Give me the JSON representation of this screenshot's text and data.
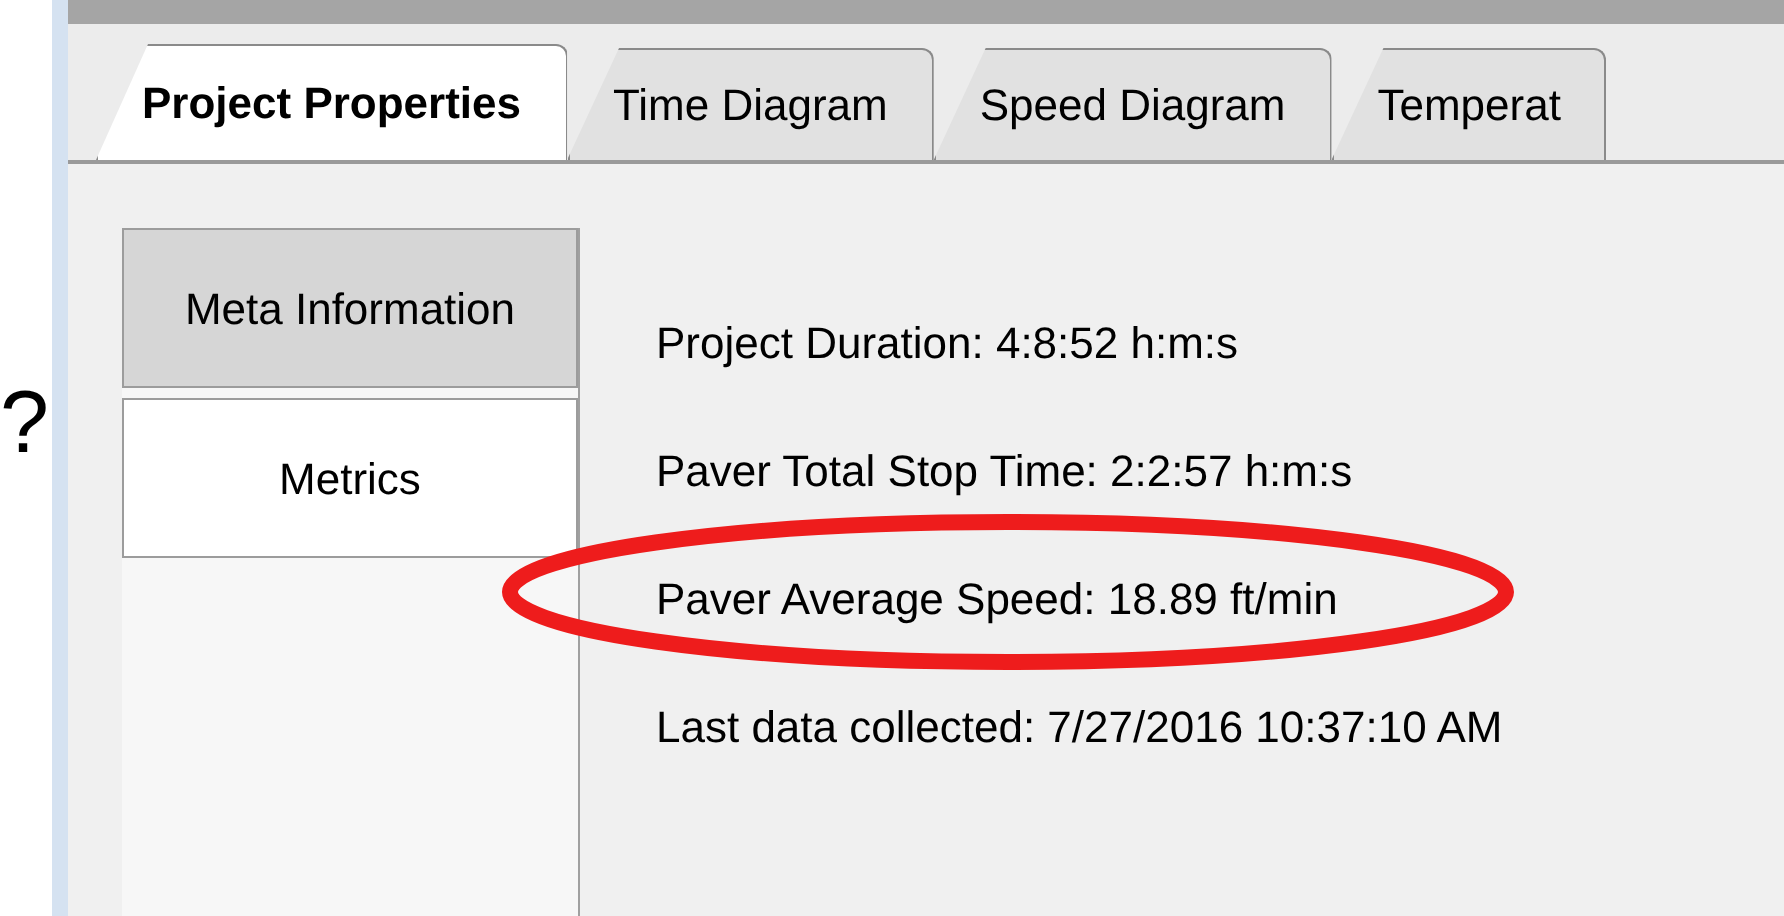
{
  "annotation": {
    "mark": "?"
  },
  "tabs": [
    {
      "label": "Project Properties",
      "selected": true
    },
    {
      "label": "Time Diagram",
      "selected": false
    },
    {
      "label": "Speed Diagram",
      "selected": false
    },
    {
      "label": "Temperat",
      "selected": false
    }
  ],
  "side_tabs": [
    {
      "label": "Meta Information",
      "selected": false
    },
    {
      "label": "Metrics",
      "selected": true
    }
  ],
  "metrics": [
    {
      "text": "Project Duration: 4:8:52 h:m:s",
      "highlighted": false
    },
    {
      "text": "Paver Total Stop Time: 2:2:57 h:m:s",
      "highlighted": false
    },
    {
      "text": "Paver Average Speed: 18.89 ft/min",
      "highlighted": true
    },
    {
      "text": "Last data collected: 7/27/2016 10:37:10 AM",
      "highlighted": false
    }
  ]
}
